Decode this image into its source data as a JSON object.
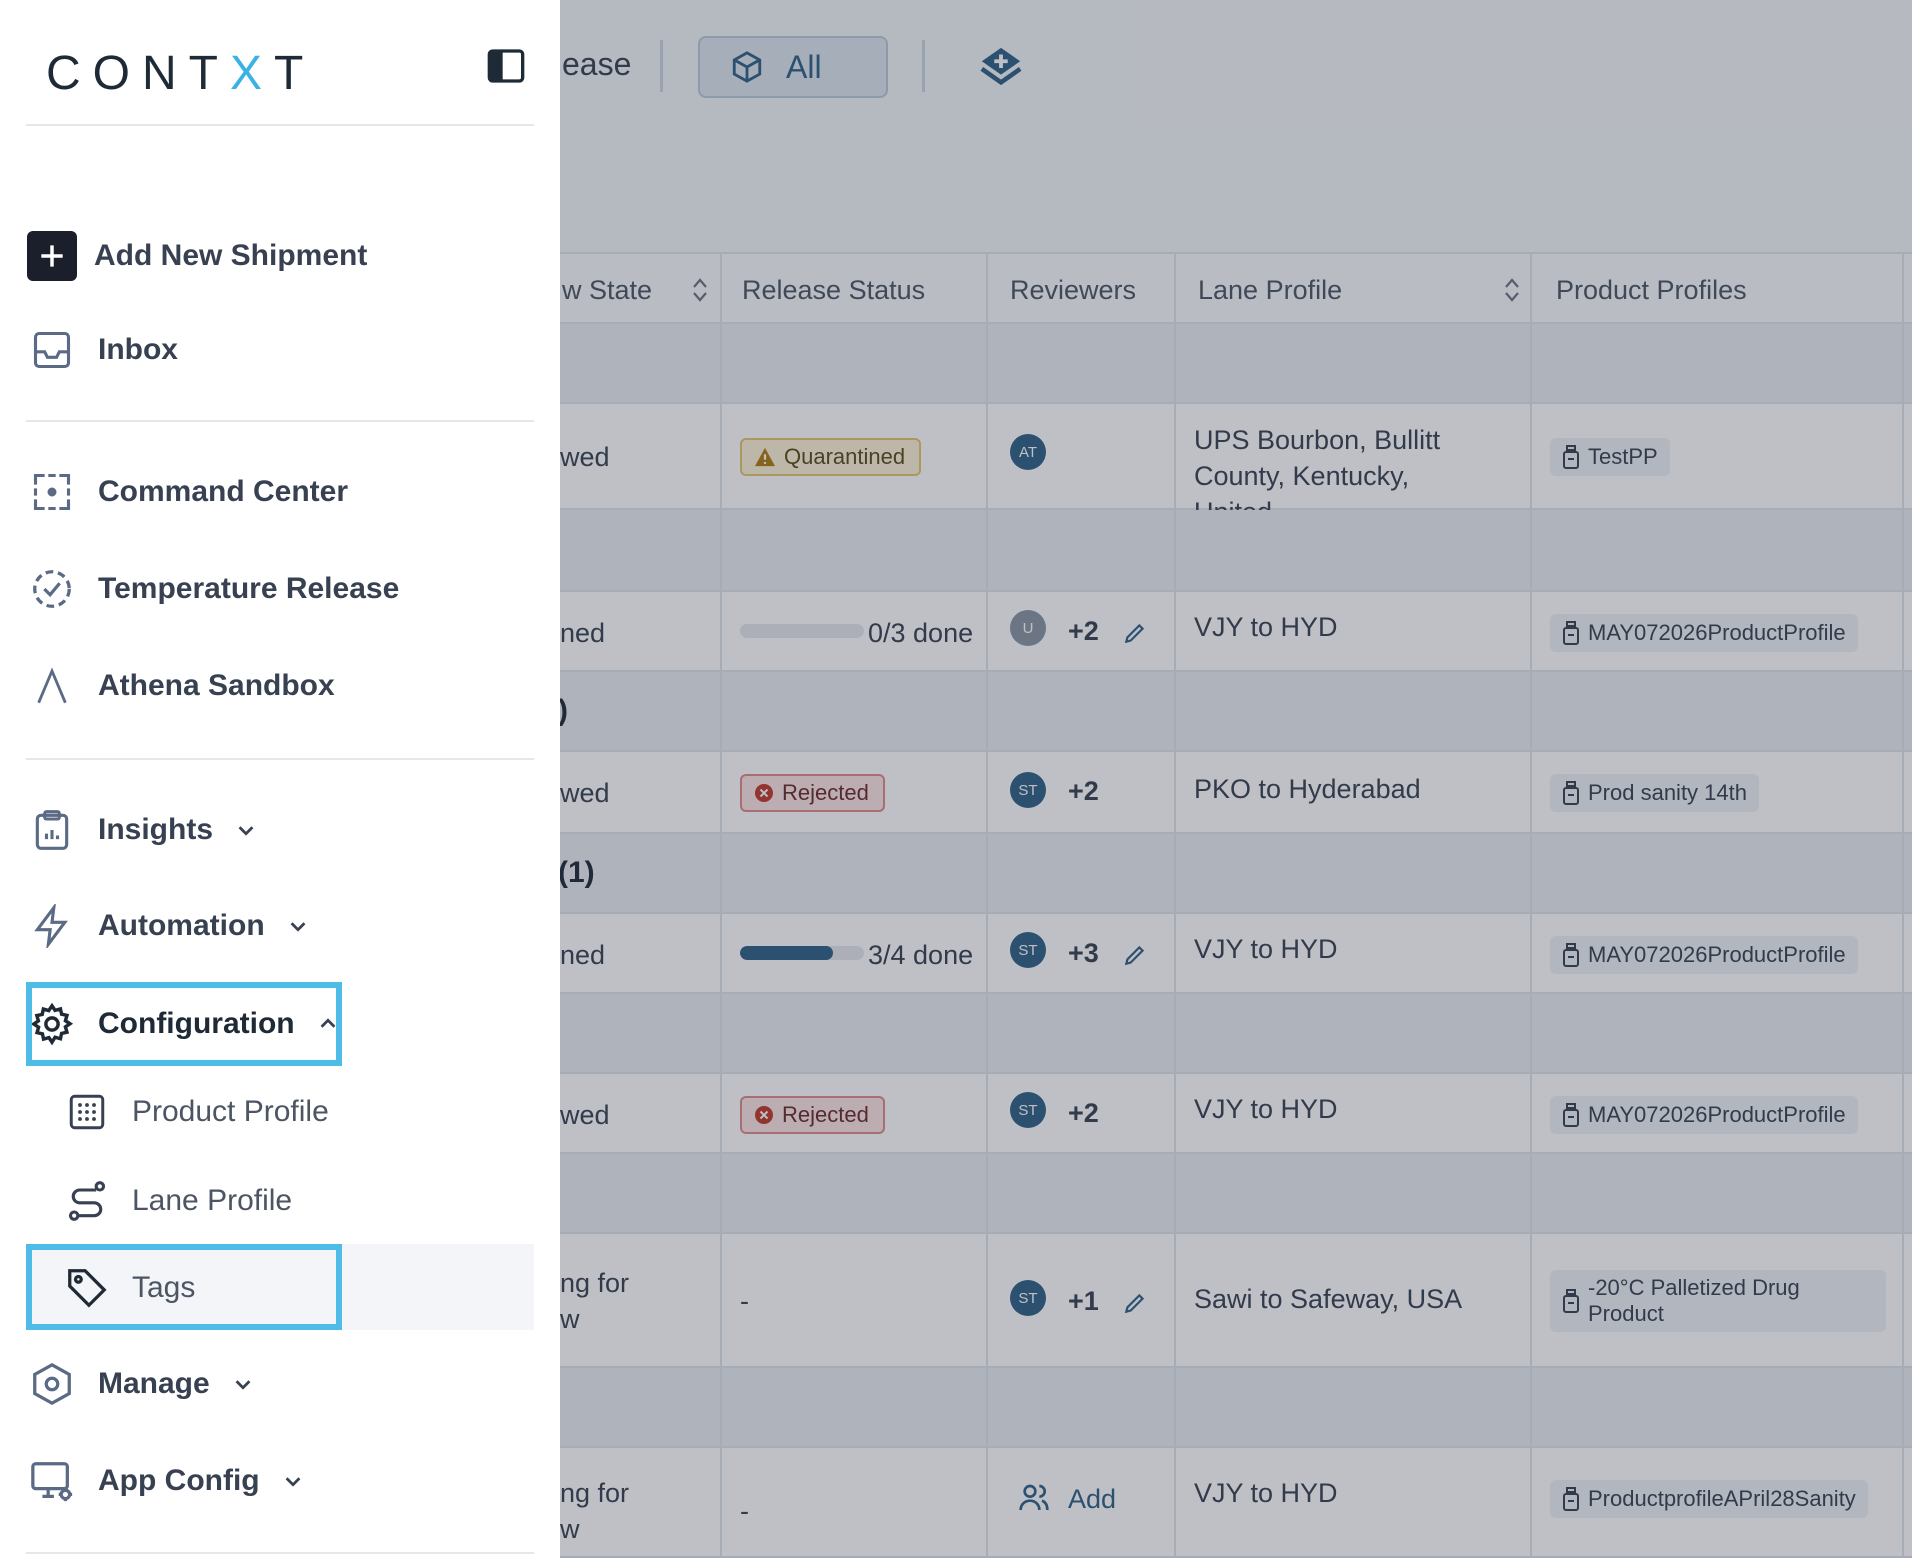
{
  "topbar": {
    "release_text": "ease",
    "all_label": "All"
  },
  "table": {
    "headers": {
      "view_state": "w State",
      "release_status": "Release Status",
      "reviewers": "Reviewers",
      "lane_profile": "Lane Profile",
      "product_profiles": "Product Profiles"
    },
    "groups": [
      ")",
      "(1)"
    ],
    "rows": [
      {
        "state": "wed",
        "status": "Quarantined",
        "avatar": "AT",
        "extra": "",
        "lane": "UPS Bourbon, Bullitt County, Kentucky, United...",
        "product": "TestPP"
      },
      {
        "state": "ned",
        "progress": "0/3 done",
        "avatar": "U",
        "extra": "+2",
        "lane": "VJY to HYD",
        "product": "MAY072026ProductProfile"
      },
      {
        "state": "wed",
        "status": "Rejected",
        "avatar": "ST",
        "extra": "+2",
        "lane": "PKO to Hyderabad",
        "product": "Prod sanity 14th"
      },
      {
        "state": "ned",
        "progress": "3/4 done",
        "avatar": "ST",
        "extra": "+3",
        "lane": "VJY to HYD",
        "product": "MAY072026ProductProfile"
      },
      {
        "state": "wed",
        "status": "Rejected",
        "avatar": "ST",
        "extra": "+2",
        "lane": "VJY to HYD",
        "product": "MAY072026ProductProfile"
      },
      {
        "state_line1": "ng for",
        "state_line2": "w",
        "status": "-",
        "avatar": "ST",
        "extra": "+1",
        "lane": "Sawi to Safeway, USA",
        "product_line1": "-20°C Palletized Drug",
        "product_line2": "Product"
      },
      {
        "state_line1": "ng for",
        "state_line2": "w",
        "status": "-",
        "add_label": "Add",
        "lane": "VJY to HYD",
        "product": "ProductprofileAPril28Sanity"
      }
    ]
  },
  "progress_values": {
    "row2": 0.0,
    "row4": 0.75
  },
  "sidebar": {
    "logo_pre": "CONT",
    "logo_x": "X",
    "logo_post": "T",
    "add_shipment": "Add New Shipment",
    "inbox": "Inbox",
    "command_center": "Command Center",
    "temperature_release": "Temperature Release",
    "athena_sandbox": "Athena Sandbox",
    "insights": "Insights",
    "automation": "Automation",
    "configuration": "Configuration",
    "product_profile": "Product Profile",
    "lane_profile": "Lane Profile",
    "tags": "Tags",
    "manage": "Manage",
    "app_config": "App Config"
  },
  "colors": {
    "accent": "#2f5f86",
    "highlight": "#4fbce8",
    "logo_x": "#3ab3e3"
  }
}
